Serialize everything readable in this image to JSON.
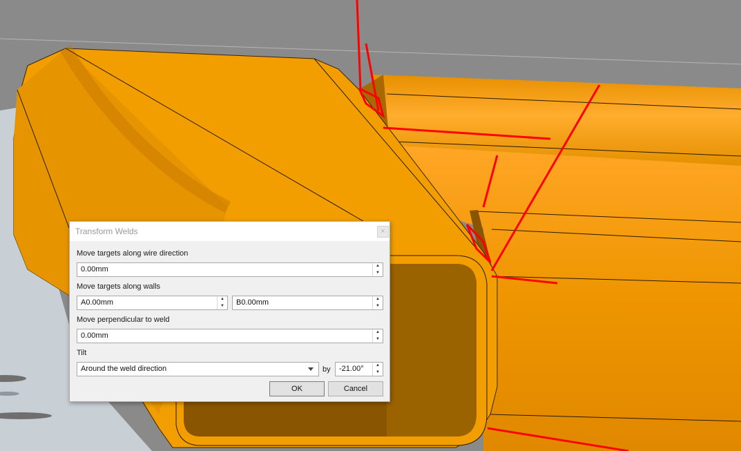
{
  "dialog": {
    "title": "Transform Welds",
    "close_symbol": "×",
    "wire_direction": {
      "label": "Move targets along wire direction",
      "value": "0.00mm"
    },
    "walls": {
      "label": "Move targets along walls",
      "a_value": "A0.00mm",
      "b_value": "B0.00mm"
    },
    "perpendicular": {
      "label": "Move perpendicular to weld",
      "value": "0.00mm"
    },
    "tilt": {
      "label": "Tilt",
      "mode": "Around the weld direction",
      "by_label": "by",
      "angle": "-21.00°"
    },
    "ok_label": "OK",
    "cancel_label": "Cancel"
  },
  "colors": {
    "tube_orange": "#f29e00",
    "weld_line_red": "#ff0000",
    "background_grey": "#8a8a8a",
    "floor": "#c8d0d6"
  }
}
